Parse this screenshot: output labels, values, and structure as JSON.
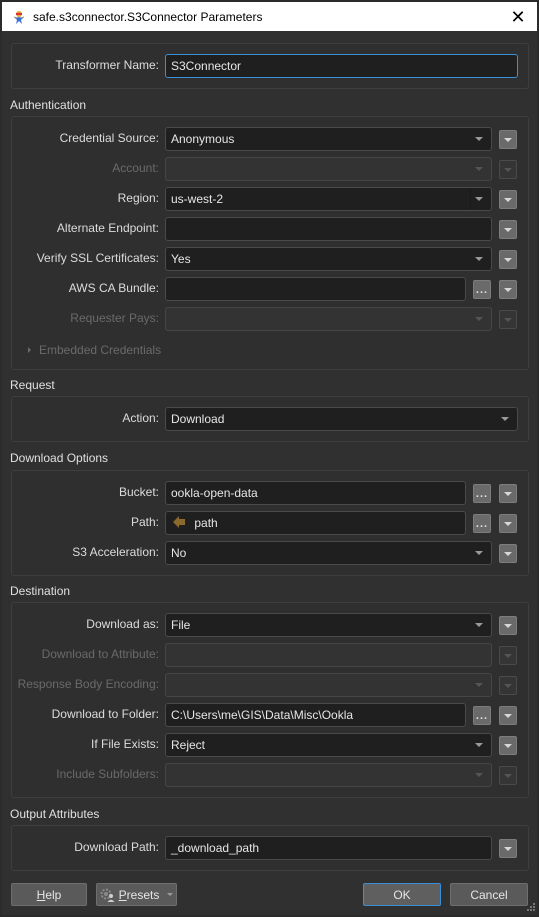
{
  "window": {
    "title": "safe.s3connector.S3Connector Parameters",
    "icon": "fme-transformer-icon",
    "close_icon": "close-icon"
  },
  "transformer_name": {
    "label": "Transformer Name:",
    "value": "S3Connector"
  },
  "authentication": {
    "title": "Authentication",
    "credential_source": {
      "label": "Credential Source:",
      "value": "Anonymous"
    },
    "account": {
      "label": "Account:",
      "value": ""
    },
    "region": {
      "label": "Region:",
      "value": "us-west-2"
    },
    "alternate_endpoint": {
      "label": "Alternate Endpoint:",
      "value": ""
    },
    "verify_ssl": {
      "label": "Verify SSL Certificates:",
      "value": "Yes"
    },
    "aws_ca_bundle": {
      "label": "AWS CA Bundle:",
      "value": ""
    },
    "requester_pays": {
      "label": "Requester Pays:",
      "value": ""
    },
    "embedded_credentials": "Embedded Credentials"
  },
  "request": {
    "title": "Request",
    "action": {
      "label": "Action:",
      "value": "Download"
    }
  },
  "download_options": {
    "title": "Download Options",
    "bucket": {
      "label": "Bucket:",
      "value": "ookla-open-data"
    },
    "path": {
      "label": "Path:",
      "value": "path",
      "icon": "attribute-arrow-icon"
    },
    "s3_acceleration": {
      "label": "S3 Acceleration:",
      "value": "No"
    }
  },
  "destination": {
    "title": "Destination",
    "download_as": {
      "label": "Download as:",
      "value": "File"
    },
    "download_to_attribute": {
      "label": "Download to Attribute:",
      "value": ""
    },
    "response_body_encoding": {
      "label": "Response Body Encoding:",
      "value": ""
    },
    "download_to_folder": {
      "label": "Download to Folder:",
      "value": "C:\\Users\\me\\GIS\\Data\\Misc\\Ookla"
    },
    "if_file_exists": {
      "label": "If File Exists:",
      "value": "Reject"
    },
    "include_subfolders": {
      "label": "Include Subfolders:",
      "value": ""
    }
  },
  "output_attributes": {
    "title": "Output Attributes",
    "download_path": {
      "label": "Download Path:",
      "value": "_download_path"
    }
  },
  "buttons": {
    "help_mnemonic": "H",
    "help_rest": "elp",
    "presets_mnemonic": "P",
    "presets_rest": "resets",
    "ok": "OK",
    "cancel": "Cancel"
  },
  "browse_label": "...",
  "colors": {
    "focus_border": "#3a8fd6",
    "attribute_icon": "#8a6a2e"
  }
}
